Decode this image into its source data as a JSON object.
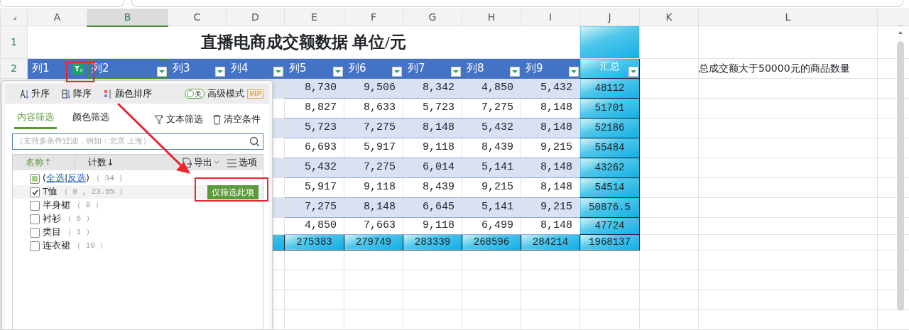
{
  "sheet": {
    "column_headers": [
      {
        "label": "A",
        "selected": false
      },
      {
        "label": "B",
        "selected": true
      },
      {
        "label": "C",
        "selected": false
      },
      {
        "label": "D",
        "selected": false
      },
      {
        "label": "E",
        "selected": false
      },
      {
        "label": "F",
        "selected": false
      },
      {
        "label": "G",
        "selected": false
      },
      {
        "label": "H",
        "selected": false
      },
      {
        "label": "I",
        "selected": false
      },
      {
        "label": "J",
        "selected": false
      },
      {
        "label": "K",
        "selected": false
      },
      {
        "label": "L",
        "selected": false
      }
    ],
    "row_numbers": [
      "1",
      "2"
    ],
    "title": "直播电商成交额数据 单位/元",
    "header_row": [
      {
        "label": "列1",
        "filtered": true,
        "selected": false
      },
      {
        "label": "列2",
        "filtered": false,
        "selected": true
      },
      {
        "label": "列3",
        "filtered": false,
        "selected": false
      },
      {
        "label": "列4",
        "filtered": false,
        "selected": false
      },
      {
        "label": "列5",
        "filtered": false,
        "selected": false
      },
      {
        "label": "列6",
        "filtered": false,
        "selected": false
      },
      {
        "label": "列7",
        "filtered": false,
        "selected": false
      },
      {
        "label": "列8",
        "filtered": false,
        "selected": false
      },
      {
        "label": "列9",
        "filtered": false,
        "selected": false
      },
      {
        "label": "汇总",
        "filtered": false,
        "selected": false
      }
    ],
    "rows": [
      {
        "values": [
          "8,730",
          "9,506",
          "8,342",
          "4,850",
          "5,432"
        ],
        "total": "48112"
      },
      {
        "values": [
          "8,827",
          "8,633",
          "5,723",
          "7,275",
          "8,148"
        ],
        "total": "51701"
      },
      {
        "values": [
          "5,723",
          "7,275",
          "8,148",
          "5,432",
          "8,148"
        ],
        "total": "52186"
      },
      {
        "values": [
          "6,693",
          "5,917",
          "9,118",
          "8,439",
          "9,215"
        ],
        "total": "55484"
      },
      {
        "values": [
          "5,432",
          "7,275",
          "6,014",
          "5,141",
          "8,148"
        ],
        "total": "43262"
      },
      {
        "values": [
          "5,917",
          "9,118",
          "8,439",
          "9,215",
          "8,148"
        ],
        "total": "54514"
      },
      {
        "values": [
          "7,275",
          "8,148",
          "6,645",
          "5,141",
          "9,215"
        ],
        "total": "50876.5"
      },
      {
        "values": [
          "4,850",
          "7,663",
          "9,118",
          "6,499",
          "8,148"
        ],
        "total": "47724"
      }
    ],
    "totals": [
      "275383",
      "279749",
      "283339",
      "268596",
      "284214",
      "1968137"
    ],
    "note": "总成交额大于50000元的商品数量"
  },
  "filter_panel": {
    "sort_buttons": [
      {
        "kind": "asc",
        "label": "升序"
      },
      {
        "kind": "desc",
        "label": "降序"
      },
      {
        "kind": "color",
        "label": "颜色排序"
      }
    ],
    "toggle": {
      "on": false,
      "label": "关"
    },
    "advanced_label": "高级模式",
    "vip_badge": "VIP",
    "tabs": [
      {
        "label": "内容筛选",
        "selected": true
      },
      {
        "label": "颜色筛选",
        "selected": false
      }
    ],
    "actions": [
      {
        "kind": "text",
        "label": "文本筛选"
      },
      {
        "kind": "clear",
        "label": "清空条件"
      }
    ],
    "search": {
      "placeholder": "（支持多条件过滤，例如：北京 上海）"
    },
    "list_header": {
      "name": "名称↑",
      "count": "计数↓",
      "export": "导出",
      "options": "选项"
    },
    "select_all": {
      "indeterminate": true,
      "open": "(",
      "all": "全选",
      "separator": "|",
      "invert": "反选",
      "close": ")",
      "count": "（ 34 ）"
    },
    "items": [
      {
        "label": "T恤",
        "count": "（ 8 , 23.5% ）",
        "checked": true,
        "hovered": true,
        "action": "仅筛选此项"
      },
      {
        "label": "半身裙",
        "count": "（ 9 ）",
        "checked": false,
        "hovered": false
      },
      {
        "label": "衬衫",
        "count": "（ 6 ）",
        "checked": false,
        "hovered": false
      },
      {
        "label": "类目",
        "count": "（ 1 ）",
        "checked": false,
        "hovered": false
      },
      {
        "label": "连衣裙",
        "count": "（ 10 ）",
        "checked": false,
        "hovered": false
      }
    ]
  }
}
